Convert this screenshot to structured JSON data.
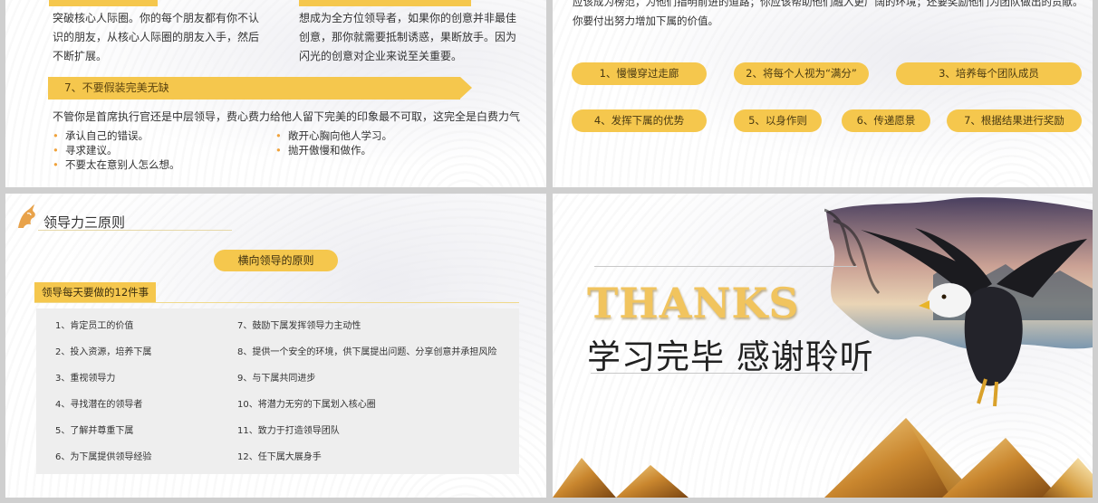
{
  "slide1": {
    "col1_text": [
      "突破核心人际圈。你的每个朋友都有你不认",
      "识的朋友，从核心人际圈的朋友入手，然后",
      "不断扩展。"
    ],
    "col2_text": [
      "想成为全方位领导者，如果你的创意并非最佳",
      "创意，那你就需要抵制诱惑，果断放手。因为",
      "闪光的创意对企业来说至关重要。"
    ],
    "banner": "7、不要假装完美无缺",
    "intro": "不管你是首席执行官还是中层领导，费心费力给他人留下完美的印象最不可取，这完全是白费力气",
    "bullets_left": [
      "承认自己的错误。",
      "寻求建议。",
      "不要太在意别人怎么想。"
    ],
    "bullets_right": [
      "敞开心胸向他人学习。",
      "抛开傲慢和做作。"
    ]
  },
  "slide2": {
    "text": [
      "应该成为榜范，为他们指明前进的道路；你应该帮助他们融入更广阔的环境；还要奖励他们为团队做出的贡献。",
      "你要付出努力增加下属的价值。"
    ],
    "pills": [
      "1、慢慢穿过走廊",
      "2、将每个人视为“满分”",
      "3、培养每个团队成员",
      "4、发挥下属的优势",
      "5、以身作则",
      "6、传递愿景",
      "7、根据结果进行奖励"
    ]
  },
  "slide3": {
    "title": "领导力三原则",
    "center_pill": "横向领导的原则",
    "sub_tag": "领导每天要做的12件事",
    "items_left": [
      "1、肯定员工的价值",
      "2、投入资源，培养下属",
      "3、重视领导力",
      "4、寻找潜在的领导者",
      "5、了解并尊重下属",
      "6、为下属提供领导经验"
    ],
    "items_right": [
      "7、鼓励下属发挥领导力主动性",
      "8、提供一个安全的环境，供下属提出问题、分享创意并承担风险",
      "9、与下属共同进步",
      "10、将潜力无穷的下属划入核心圈",
      "11、致力于打造领导团队",
      "12、任下属大展身手"
    ]
  },
  "slide4": {
    "thanks": "THANKS",
    "subtitle": "学习完毕 感谢聆听"
  },
  "colors": {
    "accent": "#f5c74d",
    "bullet": "#f0a23b",
    "panel": "#eeeeee"
  }
}
